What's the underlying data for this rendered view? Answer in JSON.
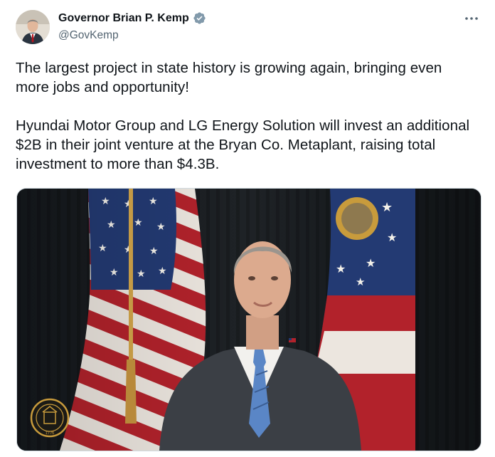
{
  "author": {
    "display_name": "Governor Brian P. Kemp",
    "handle": "@GovKemp",
    "verified_badge_icon": "verified-badge-icon",
    "verified_badge_color": "#829aab"
  },
  "post": {
    "text": "The largest project in state history is growing again, bringing even more jobs and opportunity!\n\nHyundai Motor Group and LG Energy Solution will invest an additional $2B in their joint venture at the Bryan Co. Metaplant, raising total investment to more than $4.3B."
  },
  "media": {
    "seal_text_top": "STATE OF GEORGIA",
    "seal_year": "1776"
  },
  "colors": {
    "text_primary": "#0f1419",
    "text_secondary": "#536471",
    "border": "#cfd9de"
  }
}
